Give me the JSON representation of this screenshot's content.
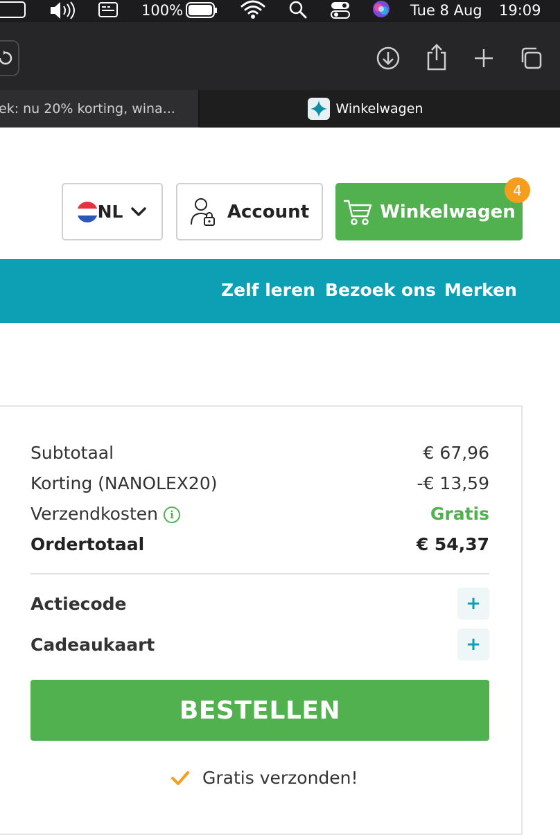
{
  "menubar": {
    "battery": "100%",
    "date": "Tue 8 Aug",
    "time": "19:09"
  },
  "tabs": {
    "inactive_title": "ek: nu 20% korting, wina...",
    "active_title": "Winkelwagen"
  },
  "header": {
    "language": "NL",
    "account_label": "Account",
    "cart_label": "Winkelwagen",
    "cart_count": "4"
  },
  "nav": {
    "items": [
      "Zelf leren",
      "Bezoek ons",
      "Merken"
    ]
  },
  "summary": {
    "subtotal_label": "Subtotaal",
    "subtotal_value": "€ 67,96",
    "discount_label": "Korting (NANOLEX20)",
    "discount_value": "-€ 13,59",
    "shipping_label": "Verzendkosten",
    "shipping_value": "Gratis",
    "total_label": "Ordertotaal",
    "total_value": "€ 54,37",
    "promo_label": "Actiecode",
    "giftcard_label": "Cadeaukaart",
    "plus_symbol": "+",
    "order_button": "BESTELLEN",
    "free_shipping_note": "Gratis verzonden!"
  },
  "colors": {
    "brand_green": "#52b14f",
    "brand_teal": "#0d9fb3",
    "badge_orange": "#f59d1d"
  }
}
